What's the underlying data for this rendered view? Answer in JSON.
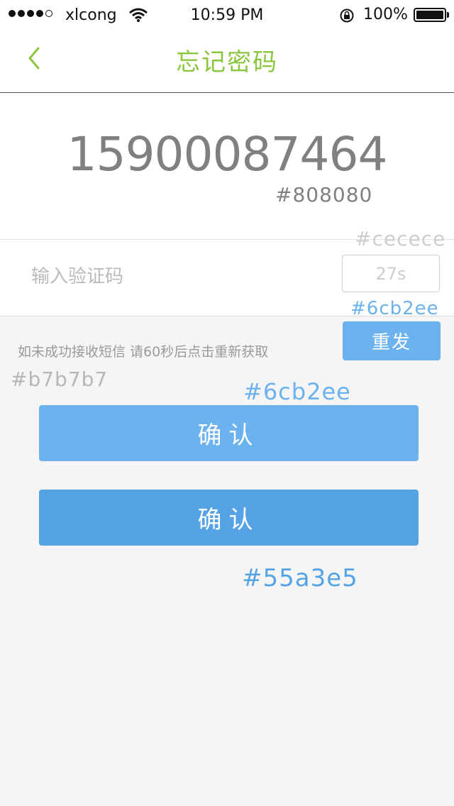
{
  "status_bar": {
    "carrier": "xlcong",
    "time": "10:59 PM",
    "battery_percent": "100%",
    "signal_bars_filled": 4,
    "signal_bars_total": 5
  },
  "nav": {
    "title": "忘记密码",
    "back_icon": "chevron-left-icon"
  },
  "phone": {
    "number": "15900087464"
  },
  "code_input": {
    "placeholder": "输入验证码",
    "value": ""
  },
  "countdown": {
    "label": "27s"
  },
  "resend": {
    "label": "重发"
  },
  "hint": {
    "text": "如未成功接收短信 请60秒后点击重新获取"
  },
  "confirm_buttons": [
    {
      "label": "确认",
      "color": "#6cb2ee"
    },
    {
      "label": "确认",
      "color": "#55a3e5"
    }
  ],
  "annotations": {
    "phone_color": "#808080",
    "border_color": "#cecece",
    "resend_color": "#6cb2ee",
    "hint_color": "#b7b7b7",
    "confirm_light_color": "#6cb2ee",
    "confirm_dark_color": "#55a3e5"
  },
  "colors": {
    "accent_green": "#8cc63f",
    "primary_blue": "#6cb2ee",
    "primary_blue_dark": "#55a3e5",
    "text_gray": "#808080",
    "border_gray": "#cecece",
    "hint_gray": "#b7b7b7",
    "background": "#f5f5f5"
  }
}
